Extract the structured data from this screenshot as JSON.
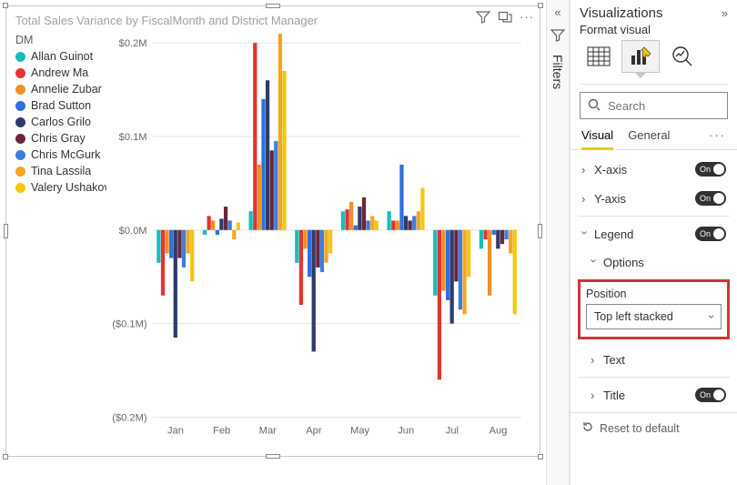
{
  "visual": {
    "title": "Total Sales Variance by FiscalMonth and District Manager",
    "legend_title": "DM",
    "legend": [
      {
        "label": "Allan Guinot",
        "color": "#17bebb"
      },
      {
        "label": "Andrew Ma",
        "color": "#e03531"
      },
      {
        "label": "Annelie Zubar",
        "color": "#f28e2b"
      },
      {
        "label": "Brad Sutton",
        "color": "#2e6fdb"
      },
      {
        "label": "Carlos Grilo",
        "color": "#2f3a6b"
      },
      {
        "label": "Chris Gray",
        "color": "#6b2737"
      },
      {
        "label": "Chris McGurk",
        "color": "#3c7de0"
      },
      {
        "label": "Tina Lassila",
        "color": "#f5a623"
      },
      {
        "label": "Valery Ushakov",
        "color": "#f2c811"
      }
    ]
  },
  "chart_data": {
    "type": "bar",
    "title": "Total Sales Variance by FiscalMonth and District Manager",
    "xlabel": "",
    "ylabel": "",
    "ylim": [
      -0.2,
      0.2
    ],
    "y_ticks": [
      "$0.2M",
      "$0.1M",
      "$0.0M",
      "($0.1M)",
      "($0.2M)"
    ],
    "categories": [
      "Jan",
      "Feb",
      "Mar",
      "Apr",
      "May",
      "Jun",
      "Jul",
      "Aug"
    ],
    "series": [
      {
        "name": "Allan Guinot",
        "color": "#17bebb",
        "values": [
          -0.035,
          -0.005,
          0.02,
          -0.035,
          0.02,
          0.02,
          -0.07,
          -0.02
        ]
      },
      {
        "name": "Andrew Ma",
        "color": "#e03531",
        "values": [
          -0.07,
          0.015,
          0.2,
          -0.08,
          0.022,
          0.01,
          -0.16,
          -0.01
        ]
      },
      {
        "name": "Annelie Zubar",
        "color": "#f28e2b",
        "values": [
          -0.025,
          0.01,
          0.07,
          -0.02,
          0.03,
          0.01,
          -0.065,
          -0.07
        ]
      },
      {
        "name": "Brad Sutton",
        "color": "#2e6fdb",
        "values": [
          -0.03,
          -0.005,
          0.14,
          -0.05,
          0.005,
          0.07,
          -0.075,
          -0.005
        ]
      },
      {
        "name": "Carlos Grilo",
        "color": "#2f3a6b",
        "values": [
          -0.115,
          0.012,
          0.16,
          -0.13,
          0.025,
          0.015,
          -0.1,
          -0.02
        ]
      },
      {
        "name": "Chris Gray",
        "color": "#6b2737",
        "values": [
          -0.03,
          0.025,
          0.085,
          -0.04,
          0.035,
          0.01,
          -0.055,
          -0.015
        ]
      },
      {
        "name": "Chris McGurk",
        "color": "#3c7de0",
        "values": [
          -0.04,
          0.01,
          0.095,
          -0.045,
          0.01,
          0.015,
          -0.085,
          -0.01
        ]
      },
      {
        "name": "Tina Lassila",
        "color": "#f5a623",
        "values": [
          -0.025,
          -0.01,
          0.21,
          -0.035,
          0.015,
          0.02,
          -0.09,
          -0.025
        ]
      },
      {
        "name": "Valery Ushakov",
        "color": "#f2c811",
        "values": [
          -0.055,
          0.008,
          0.17,
          -0.025,
          0.01,
          0.045,
          -0.05,
          -0.09
        ]
      }
    ]
  },
  "filters_rail": {
    "label": "Filters"
  },
  "viz": {
    "title": "Visualizations",
    "subtitle": "Format visual",
    "search_placeholder": "Search",
    "tabs": {
      "visual": "Visual",
      "general": "General"
    },
    "sections": {
      "xaxis": "X-axis",
      "yaxis": "Y-axis",
      "legend": "Legend",
      "options": "Options",
      "position_label": "Position",
      "position_value": "Top left stacked",
      "text": "Text",
      "title": "Title",
      "toggle_on": "On"
    },
    "reset": "Reset to default"
  }
}
